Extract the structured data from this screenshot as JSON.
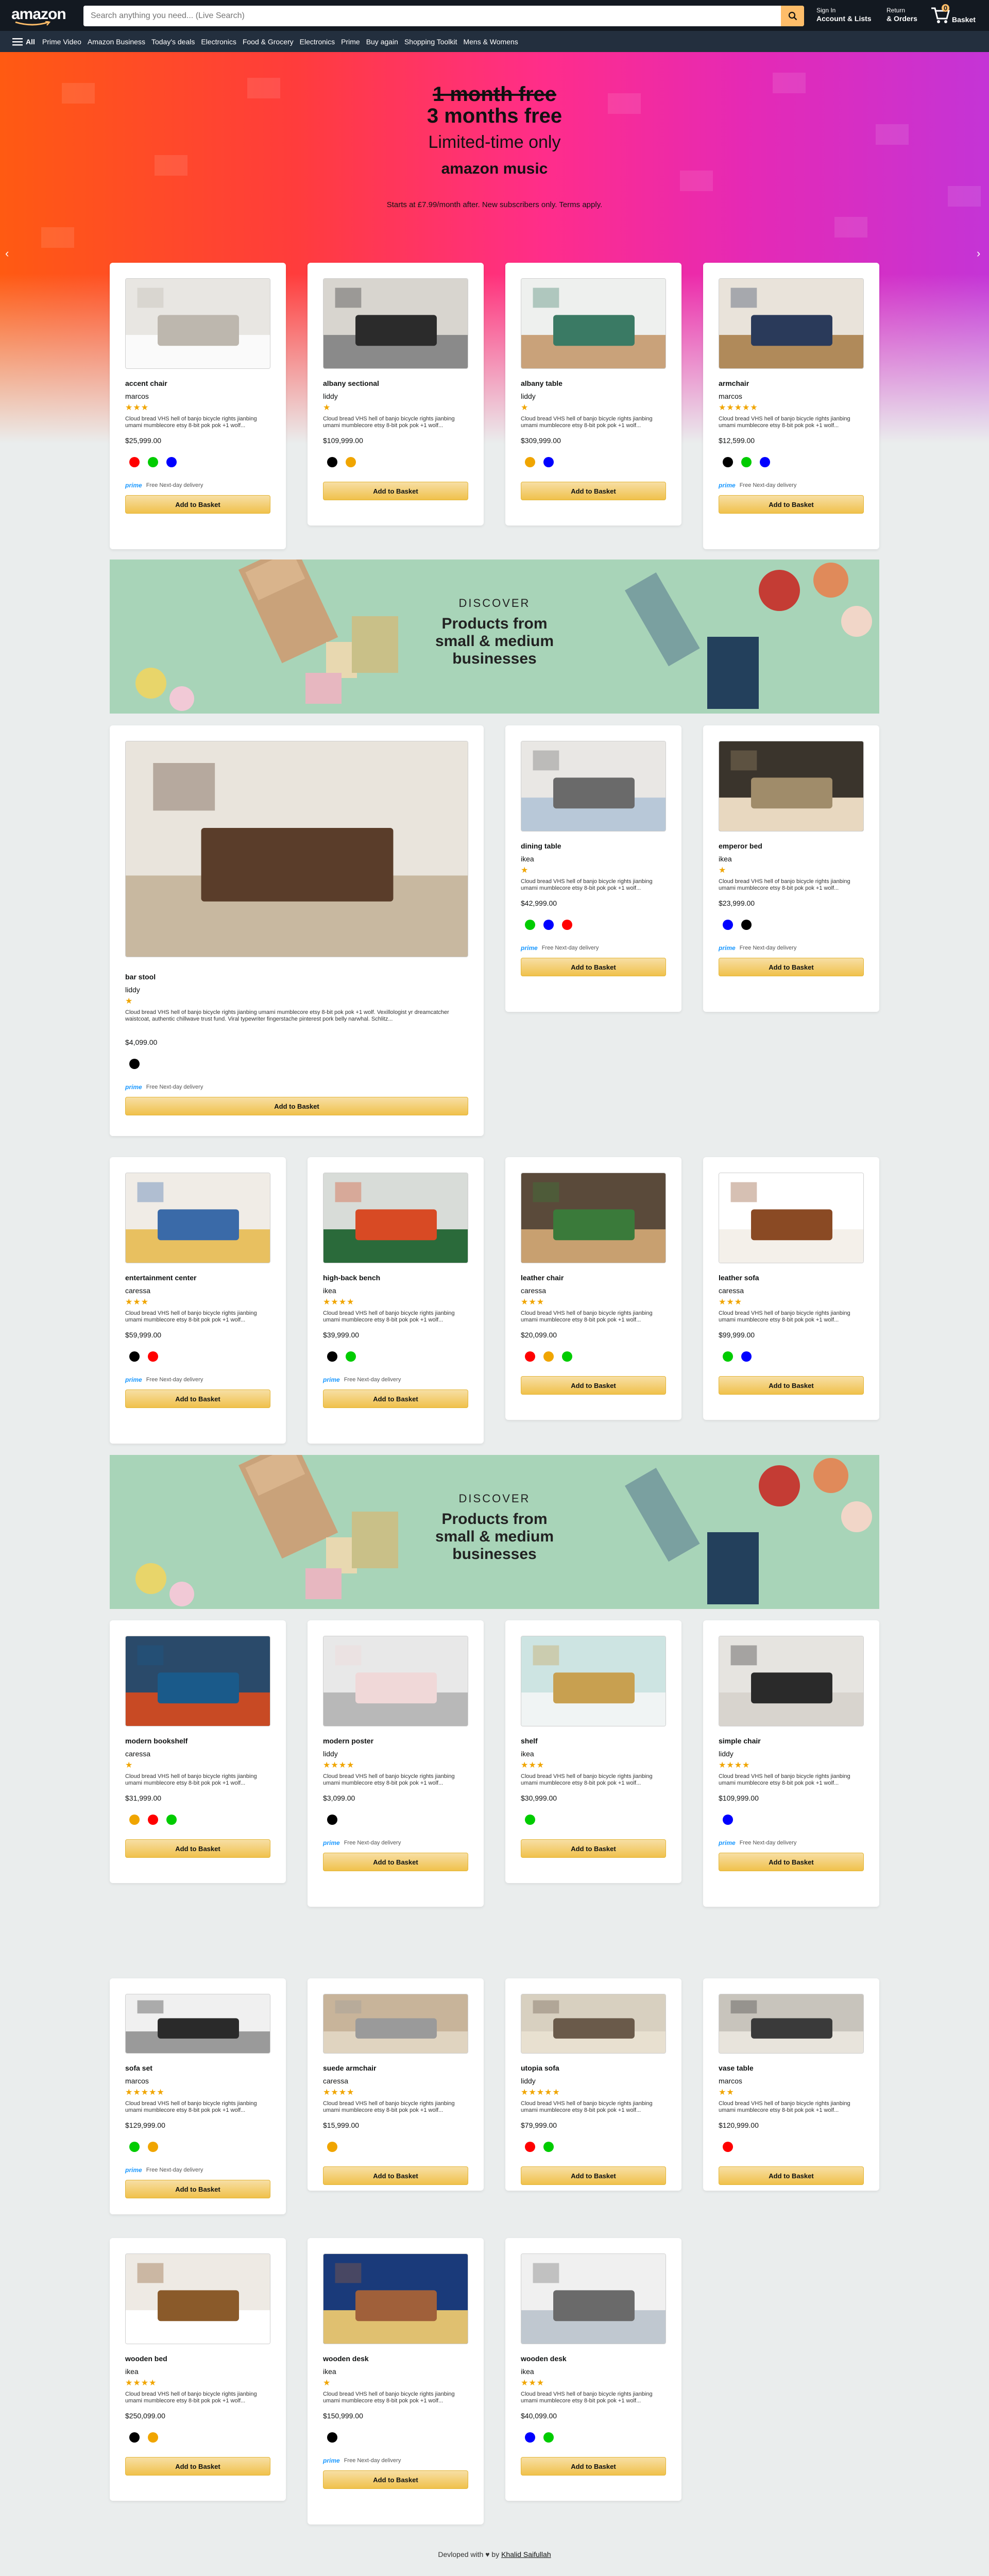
{
  "header": {
    "logo": "amazon",
    "search_placeholder": "Search anything you need... (Live Search)",
    "signin_line1": "Sign In",
    "signin_line2": "Account & Lists",
    "returns_line1": "Return",
    "returns_line2": "& Orders",
    "cart_count": "0",
    "cart_label": "Basket"
  },
  "subnav": {
    "all_label": "All",
    "items": [
      "Prime Video",
      "Amazon Business",
      "Today's deals",
      "Electronics",
      "Food & Grocery",
      "Electronics",
      "Prime",
      "Buy again",
      "Shopping Toolkit",
      "Mens & Womens"
    ]
  },
  "hero": {
    "old_offer": "1 month free",
    "new_offer": "3 months free",
    "tagline": "Limited-time only",
    "brand": "amazon music",
    "terms": "Starts at £7.99/month after. New subscribers only. Terms apply.",
    "prev_icon": "chevron-left",
    "next_icon": "chevron-right"
  },
  "common": {
    "desc": "Cloud bread VHS hell of banjo bicycle rights jianbing umami mumblecore etsy 8-bit pok pok +1 wolf...",
    "prime_label": "prime",
    "prime_text": "Free Next-day delivery",
    "button_label": "Add to Basket"
  },
  "banner": {
    "discover": "DISCOVER",
    "title": "Products from small & medium businesses"
  },
  "products": [
    {
      "name": "accent chair",
      "brand": "marcos",
      "stars": "★★★",
      "price": "$25,999.00",
      "colors": [
        "#ff0000",
        "#00cc00",
        "#0000ff"
      ],
      "prime": true,
      "img": "chair-white"
    },
    {
      "name": "albany sectional",
      "brand": "liddy",
      "stars": "★",
      "price": "$109,999.00",
      "colors": [
        "#000000",
        "#f0a500"
      ],
      "prime": false,
      "img": "sofa-dark"
    },
    {
      "name": "albany table",
      "brand": "liddy",
      "stars": "★",
      "price": "$309,999.00",
      "colors": [
        "#f0a500",
        "#0000ff"
      ],
      "prime": false,
      "img": "table-green"
    },
    {
      "name": "armchair",
      "brand": "marcos",
      "stars": "★★★★★",
      "price": "$12,599.00",
      "colors": [
        "#000000",
        "#00cc00",
        "#0000ff"
      ],
      "prime": true,
      "img": "shelf-room"
    },
    {
      "name": "bar stool",
      "brand": "liddy",
      "stars": "★",
      "price": "$4,099.00",
      "desc": "Cloud bread VHS hell of banjo bicycle rights jianbing umami mumblecore etsy 8-bit pok pok +1 wolf. Vexillologist yr dreamcatcher waistcoat, authentic chillwave trust fund. Viral typewriter fingerstache pinterest pork belly narwhal. Schlitz...",
      "colors": [
        "#000000"
      ],
      "prime": true,
      "img": "kitchen"
    },
    {
      "name": "dining table",
      "brand": "ikea",
      "stars": "★",
      "price": "$42,999.00",
      "colors": [
        "#00cc00",
        "#0000ff",
        "#ff0000"
      ],
      "prime": true,
      "img": "dining"
    },
    {
      "name": "emperor bed",
      "brand": "ikea",
      "stars": "★",
      "price": "$23,999.00",
      "colors": [
        "#0000ff",
        "#000000"
      ],
      "prime": true,
      "img": "bedroom"
    },
    {
      "name": "entertainment center",
      "brand": "caressa",
      "stars": "★★★",
      "price": "$59,999.00",
      "colors": [
        "#000000",
        "#ff0000"
      ],
      "prime": true,
      "img": "cabinet"
    },
    {
      "name": "high-back bench",
      "brand": "ikea",
      "stars": "★★★★",
      "price": "$39,999.00",
      "colors": [
        "#000000",
        "#00cc00"
      ],
      "prime": true,
      "img": "chairs"
    },
    {
      "name": "leather chair",
      "brand": "caressa",
      "stars": "★★★",
      "price": "$20,099.00",
      "colors": [
        "#ff0000",
        "#f0a500",
        "#00cc00"
      ],
      "prime": false,
      "img": "plants"
    },
    {
      "name": "leather sofa",
      "brand": "caressa",
      "stars": "★★★",
      "price": "$99,999.00",
      "colors": [
        "#00cc00",
        "#0000ff"
      ],
      "prime": false,
      "img": "sofa-brown"
    },
    {
      "name": "modern bookshelf",
      "brand": "caressa",
      "stars": "★",
      "price": "$31,999.00",
      "colors": [
        "#f0a500",
        "#ff0000",
        "#00cc00"
      ],
      "prime": false,
      "img": "blue-room"
    },
    {
      "name": "modern poster",
      "brand": "liddy",
      "stars": "★★★★",
      "price": "$3,099.00",
      "colors": [
        "#000000"
      ],
      "prime": true,
      "img": "poster"
    },
    {
      "name": "shelf",
      "brand": "ikea",
      "stars": "★★★",
      "price": "$30,999.00",
      "colors": [
        "#00cc00"
      ],
      "prime": false,
      "img": "shelf"
    },
    {
      "name": "simple chair",
      "brand": "liddy",
      "stars": "★★★★",
      "price": "$109,999.00",
      "colors": [
        "#0000ff"
      ],
      "prime": true,
      "img": "simple-chair"
    },
    {
      "name": "sofa set",
      "brand": "marcos",
      "stars": "★★★★★",
      "price": "$129,999.00",
      "colors": [
        "#00cc00",
        "#f0a500"
      ],
      "prime": true,
      "img": "sofa-set"
    },
    {
      "name": "suede armchair",
      "brand": "caressa",
      "stars": "★★★★",
      "price": "$15,999.00",
      "colors": [
        "#f0a500"
      ],
      "prime": false,
      "img": "armchairs"
    },
    {
      "name": "utopia sofa",
      "brand": "liddy",
      "stars": "★★★★★",
      "price": "$79,999.00",
      "colors": [
        "#ff0000",
        "#00cc00"
      ],
      "prime": false,
      "img": "utopia"
    },
    {
      "name": "vase table",
      "brand": "marcos",
      "stars": "★★",
      "price": "$120,999.00",
      "colors": [
        "#ff0000"
      ],
      "prime": false,
      "img": "vase"
    },
    {
      "name": "wooden bed",
      "brand": "ikea",
      "stars": "★★★★",
      "price": "$250,099.00",
      "colors": [
        "#000000",
        "#f0a500"
      ],
      "prime": false,
      "img": "wood-bed"
    },
    {
      "name": "wooden desk",
      "brand": "ikea",
      "stars": "★",
      "price": "$150,999.00",
      "colors": [
        "#000000"
      ],
      "prime": true,
      "img": "desk-blue"
    },
    {
      "name": "wooden desk",
      "brand": "ikea",
      "stars": "★★★",
      "price": "$40,099.00",
      "colors": [
        "#0000ff",
        "#00cc00"
      ],
      "prime": false,
      "img": "office"
    }
  ],
  "footer": {
    "text": "Devloped with ♥ by",
    "author": "Khalid Saifullah"
  }
}
